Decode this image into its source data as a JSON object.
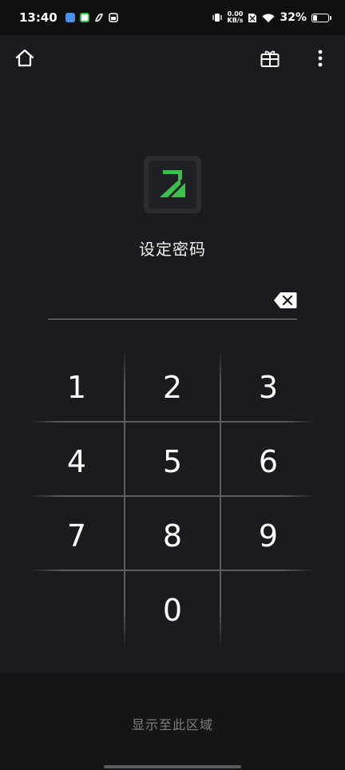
{
  "status_bar": {
    "time": "13:40",
    "net_speed_value": "0.00",
    "net_speed_unit": "KB/s",
    "battery_percent": "32%",
    "battery_level": 0.32,
    "notification_icons": [
      "app-icon-blue",
      "app-icon-green",
      "app-icon-white",
      "app-icon-box"
    ]
  },
  "top_bar": {
    "home_icon": "home-icon",
    "gift_icon": "gift-icon",
    "menu_icon": "more-vert-icon"
  },
  "app_icon": "lock-logo-icon",
  "prompt": "设定密码",
  "pin_field": {
    "value": "",
    "backspace_icon": "backspace-icon"
  },
  "keypad": {
    "keys": [
      "1",
      "2",
      "3",
      "4",
      "5",
      "6",
      "7",
      "8",
      "9",
      "0"
    ]
  },
  "bottom": {
    "label": "显示至此区域"
  },
  "colors": {
    "background": "#1a1b1e",
    "accent_green": "#3bbf4a",
    "divider": "#5a5c61",
    "muted_text": "#7d7e82"
  }
}
